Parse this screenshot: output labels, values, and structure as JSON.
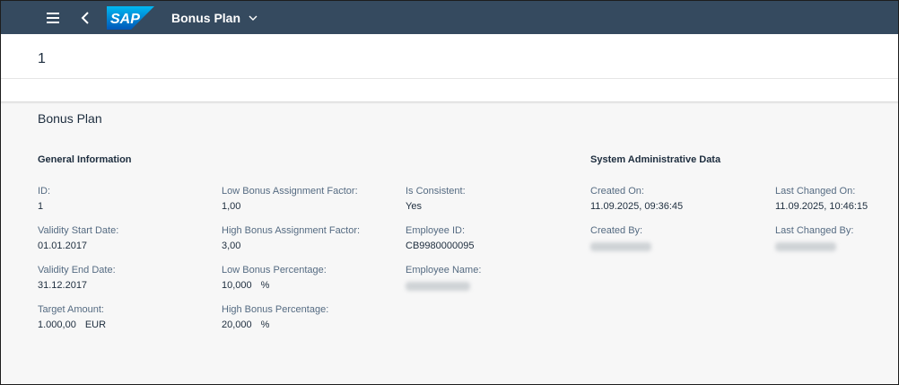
{
  "shell": {
    "title": "Bonus Plan",
    "logo_text": "SAP",
    "icons": {
      "menu": "hamburger-icon",
      "back": "back-chevron-icon",
      "title_dropdown": "chevron-down-icon"
    }
  },
  "header": {
    "object_title": "1"
  },
  "section": {
    "title": "Bonus Plan",
    "general_information": {
      "title": "General Information",
      "fields": {
        "id": {
          "label": "ID:",
          "value": "1"
        },
        "validity_start": {
          "label": "Validity Start Date:",
          "value": "01.01.2017"
        },
        "validity_end": {
          "label": "Validity End Date:",
          "value": "31.12.2017"
        },
        "target_amount": {
          "label": "Target Amount:",
          "value": "1.000,00",
          "unit": "EUR"
        },
        "low_bonus_factor": {
          "label": "Low Bonus Assignment Factor:",
          "value": "1,00"
        },
        "high_bonus_factor": {
          "label": "High Bonus Assignment Factor:",
          "value": "3,00"
        },
        "low_bonus_pct": {
          "label": "Low Bonus Percentage:",
          "value": "10,000",
          "unit": "%"
        },
        "high_bonus_pct": {
          "label": "High Bonus Percentage:",
          "value": "20,000",
          "unit": "%"
        },
        "is_consistent": {
          "label": "Is Consistent:",
          "value": "Yes"
        },
        "employee_id": {
          "label": "Employee ID:",
          "value": "CB9980000095"
        },
        "employee_name": {
          "label": "Employee Name:"
        }
      }
    },
    "system_admin": {
      "title": "System Administrative Data",
      "fields": {
        "created_on": {
          "label": "Created On:",
          "value": "11.09.2025, 09:36:45"
        },
        "last_changed_on": {
          "label": "Last Changed On:",
          "value": "11.09.2025, 10:46:15"
        },
        "created_by": {
          "label": "Created By:"
        },
        "last_changed_by": {
          "label": "Last Changed By:"
        }
      }
    }
  },
  "colors": {
    "shell_bg": "#354a5f",
    "page_bg": "#f7f7f7",
    "logo_blue": "#0a6ed1",
    "label": "#556b82",
    "text": "#1d2d3e"
  }
}
